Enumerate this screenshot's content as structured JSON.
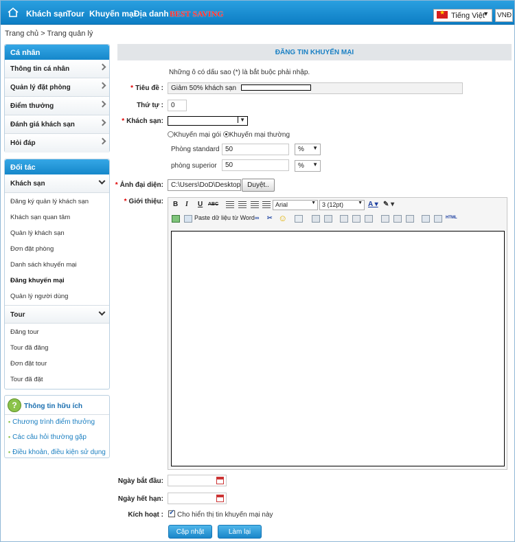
{
  "topnav": {
    "items": [
      "Khách sạn",
      "Tour",
      "Khuyến mại",
      "Địa danh"
    ],
    "promo": "BEST SAVING",
    "language": "Tiếng Việt",
    "currency": "VNĐ"
  },
  "breadcrumb": {
    "home": "Trang chủ",
    "sep": ">",
    "current": "Trang quản lý"
  },
  "sidebar": {
    "personal_title": "Cá nhân",
    "personal_items": [
      "Thông tin cá nhân",
      "Quản lý đặt phòng",
      "Điểm thưởng",
      "Đánh giá khách sạn",
      "Hỏi đáp"
    ],
    "partner_title": "Đối tác",
    "hotel_group": "Khách sạn",
    "hotel_items": [
      "Đăng ký quản lý khách sạn",
      "Khách sạn quan tâm",
      "Quản lý khách sạn",
      "Đơn đặt phòng",
      "Danh sách khuyến mại",
      "Đăng khuyến mại",
      "Quản lý người dùng"
    ],
    "tour_group": "Tour",
    "tour_items": [
      "Đăng tour",
      "Tour đã đăng",
      "Đơn đặt tour",
      "Tour đã đặt"
    ],
    "info_title": "Thông tin hữu ích",
    "info_links": [
      "Chương trình điểm thưởng",
      "Các câu hỏi thường gặp",
      "Điều khoản, điều kiện sử dụng"
    ]
  },
  "form": {
    "header": "ĐĂNG TIN KHUYẾN MẠI",
    "note": "Những ô có dấu sao (*) là bắt buộc phải nhập.",
    "title_label": "Tiêu đề :",
    "title_value": "Giảm 50% khách sạn",
    "order_label": "Thứ tự :",
    "order_value": "0",
    "hotel_label": "Khách sạn:",
    "promo_type_package": "Khuyến mại gói",
    "promo_type_regular": "Khuyến mại thường",
    "rooms": [
      {
        "name": "Phòng standard",
        "value": "50",
        "unit": "%"
      },
      {
        "name": "phòng superior",
        "value": "50",
        "unit": "%"
      }
    ],
    "image_label": "Ảnh đại diện:",
    "image_path": "C:\\Users\\DoD\\Desktop\\IM",
    "browse_button": "Duyệt..",
    "intro_label": "Giới thiệu:",
    "editor": {
      "font": "Arial",
      "size": "3 (12pt)",
      "paste_word": "Paste dữ liệu từ Word",
      "bold": "B",
      "italic": "I",
      "underline": "U",
      "strike": "ABC",
      "html": "HTML"
    },
    "start_label": "Ngày bắt đầu:",
    "end_label": "Ngày hết hạn:",
    "active_label": "Kích hoạt :",
    "active_text": "Cho hiển thị tin khuyến mại này",
    "submit_button": "Cập nhật",
    "reset_button": "Làm lại"
  }
}
